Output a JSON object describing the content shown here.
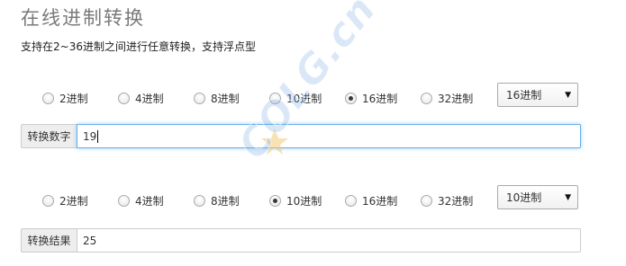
{
  "page": {
    "title": "在线进制转换",
    "description": "支持在2~36进制之间进行任意转换，支持浮点型"
  },
  "input_section": {
    "radios": [
      {
        "label": "2进制",
        "checked": false
      },
      {
        "label": "4进制",
        "checked": false
      },
      {
        "label": "8进制",
        "checked": false
      },
      {
        "label": "10进制",
        "checked": false
      },
      {
        "label": "16进制",
        "checked": true
      },
      {
        "label": "32进制",
        "checked": false
      }
    ],
    "select_value": "16进制",
    "field_label": "转换数字",
    "field_value": "19"
  },
  "output_section": {
    "radios": [
      {
        "label": "2进制",
        "checked": false
      },
      {
        "label": "4进制",
        "checked": false
      },
      {
        "label": "8进制",
        "checked": false
      },
      {
        "label": "10进制",
        "checked": true
      },
      {
        "label": "16进制",
        "checked": false
      },
      {
        "label": "32进制",
        "checked": false
      }
    ],
    "select_value": "10进制",
    "field_label": "转换结果",
    "field_value": "25"
  },
  "watermark": {
    "text": "COLG.cn",
    "color": "#78aae1"
  },
  "icons": {
    "select_arrow": "chevron-down-icon",
    "watermark_star": "star-icon"
  }
}
